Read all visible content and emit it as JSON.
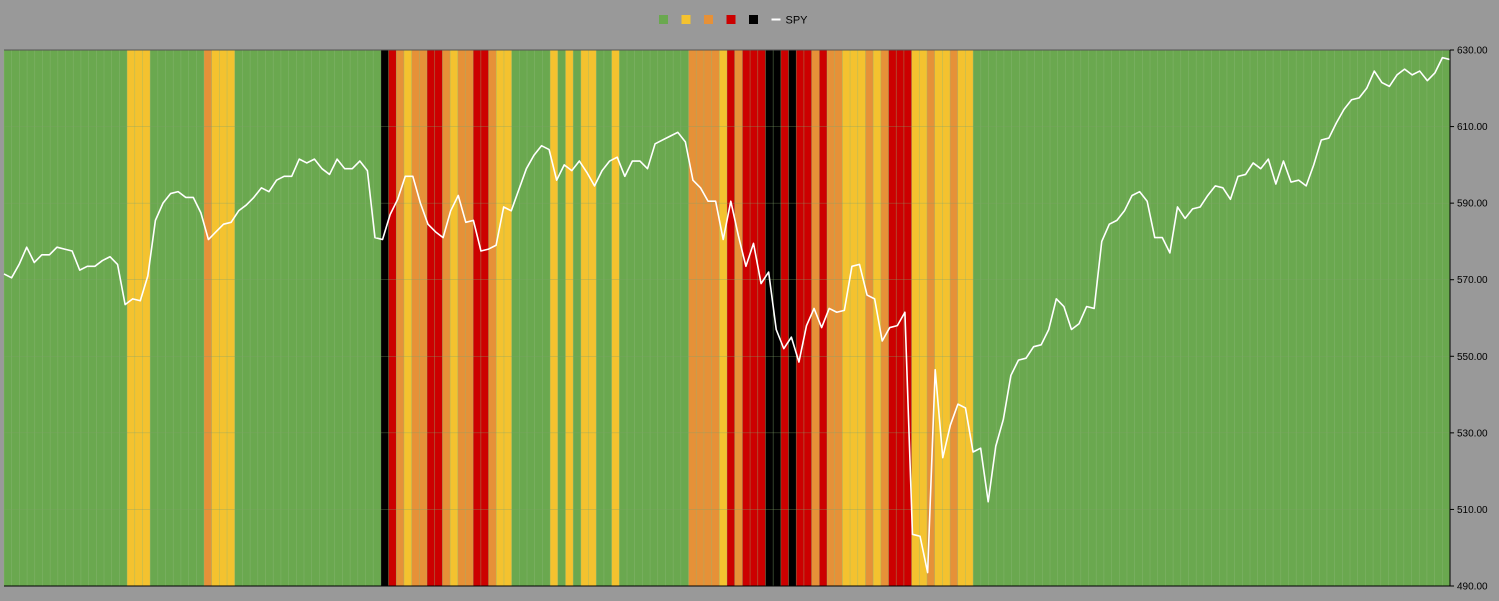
{
  "chart_data": {
    "type": "line",
    "title": "",
    "xlabel": "",
    "ylabel": "",
    "ylim": [
      490,
      630
    ],
    "y_ticks": [
      "490.00",
      "510.00",
      "530.00",
      "550.00",
      "570.00",
      "610.00",
      "590.00",
      "630.00"
    ],
    "y_tick_values": [
      490,
      510,
      530,
      550,
      570,
      610,
      590,
      630
    ],
    "y_axis_side": "right",
    "legend_position": "top-center",
    "background_color": "#999999",
    "plot_background_color": "#6aa84f",
    "regime_colors": {
      "green": "#6aa84f",
      "yellow": "#f4c22f",
      "orange": "#e69138",
      "red": "#cc0000",
      "black": "#000000"
    },
    "legend": [
      {
        "color": "#6aa84f",
        "label": "",
        "marker": "square"
      },
      {
        "color": "#f4c22f",
        "label": "",
        "marker": "square"
      },
      {
        "color": "#e69138",
        "label": "",
        "marker": "square"
      },
      {
        "color": "#cc0000",
        "label": "",
        "marker": "square"
      },
      {
        "color": "#000000",
        "label": "",
        "marker": "square"
      },
      {
        "color": "#ffffff",
        "label": "SPY",
        "marker": "line"
      }
    ],
    "regimes": [
      "green",
      "green",
      "green",
      "green",
      "green",
      "green",
      "green",
      "green",
      "green",
      "green",
      "green",
      "green",
      "green",
      "green",
      "green",
      "green",
      "yellow",
      "yellow",
      "yellow",
      "green",
      "green",
      "green",
      "green",
      "green",
      "green",
      "green",
      "orange",
      "yellow",
      "yellow",
      "yellow",
      "green",
      "green",
      "green",
      "green",
      "green",
      "green",
      "green",
      "green",
      "green",
      "green",
      "green",
      "green",
      "green",
      "green",
      "green",
      "green",
      "green",
      "green",
      "green",
      "black",
      "red",
      "orange",
      "yellow",
      "orange",
      "orange",
      "red",
      "red",
      "orange",
      "yellow",
      "orange",
      "orange",
      "red",
      "red",
      "orange",
      "yellow",
      "yellow",
      "green",
      "green",
      "green",
      "green",
      "green",
      "yellow",
      "green",
      "yellow",
      "green",
      "yellow",
      "yellow",
      "green",
      "green",
      "yellow",
      "green",
      "green",
      "green",
      "green",
      "green",
      "green",
      "green",
      "green",
      "green",
      "orange",
      "orange",
      "orange",
      "orange",
      "yellow",
      "red",
      "orange",
      "red",
      "red",
      "red",
      "black",
      "black",
      "red",
      "black",
      "red",
      "red",
      "orange",
      "red",
      "orange",
      "orange",
      "yellow",
      "yellow",
      "yellow",
      "orange",
      "yellow",
      "orange",
      "red",
      "red",
      "red",
      "yellow",
      "yellow",
      "orange",
      "yellow",
      "yellow",
      "orange",
      "yellow",
      "yellow",
      "green",
      "green",
      "green",
      "green",
      "green",
      "green",
      "green",
      "green",
      "green",
      "green",
      "green",
      "green",
      "green",
      "green",
      "green",
      "green",
      "green",
      "green",
      "green",
      "green",
      "green",
      "green",
      "green",
      "green",
      "green",
      "green",
      "green",
      "green",
      "green",
      "green",
      "green",
      "green",
      "green",
      "green",
      "green",
      "green",
      "green",
      "green",
      "green",
      "green",
      "green",
      "green",
      "green",
      "green",
      "green",
      "green",
      "green",
      "green",
      "green",
      "green",
      "green",
      "green",
      "green",
      "green",
      "green",
      "green",
      "green",
      "green",
      "green",
      "green",
      "green",
      "green"
    ],
    "series": [
      {
        "name": "SPY",
        "color": "#ffffff",
        "values": [
          571.5,
          570.5,
          574,
          578.5,
          574.5,
          576.5,
          576.5,
          578.5,
          578,
          577.5,
          572.5,
          573.5,
          573.5,
          575,
          576,
          574,
          563.5,
          565,
          564.5,
          571,
          585.5,
          590,
          592.5,
          593,
          591.5,
          591.5,
          587.5,
          580.5,
          582.5,
          584.5,
          585,
          588,
          589.5,
          591.5,
          594,
          593,
          596,
          597,
          597,
          601.5,
          600.5,
          601.5,
          599,
          597.5,
          601.5,
          599,
          599,
          601,
          598.5,
          581,
          580.5,
          587,
          591,
          597,
          597,
          590,
          584.5,
          582.5,
          581,
          588,
          592,
          585,
          585.5,
          577.5,
          578,
          579,
          589,
          588,
          593.5,
          599,
          602.5,
          605,
          604,
          596,
          600,
          598.5,
          601,
          598,
          594.5,
          598.5,
          601,
          602,
          597,
          601,
          601,
          599,
          605.5,
          606.5,
          607.5,
          608.5,
          606,
          596,
          594,
          590.5,
          590.5,
          580.5,
          590.5,
          581.5,
          573.5,
          579.5,
          569,
          572,
          557,
          552,
          555,
          548.5,
          558,
          562.5,
          557.5,
          562.5,
          561.5,
          562,
          573.5,
          574,
          566,
          565,
          554,
          557.5,
          558,
          561.5,
          503.5,
          503,
          493.5,
          546.5,
          523.5,
          532,
          537.5,
          536.5,
          525,
          526,
          512,
          526.5,
          533.5,
          545,
          549,
          549.5,
          552.5,
          553,
          557,
          565,
          563,
          557,
          558.5,
          563,
          562.5,
          580,
          584.5,
          585.5,
          588,
          592,
          593,
          590.5,
          581,
          581,
          577,
          589,
          586,
          588.5,
          589,
          592,
          594.5,
          594,
          591,
          597,
          597.5,
          600.5,
          599,
          601.5,
          595,
          601,
          595.5,
          596,
          594.5,
          600,
          606.5,
          607,
          611,
          614.5,
          617,
          617.5,
          620,
          624.5,
          621.5,
          620.5,
          623.5,
          625,
          623.5,
          624.5,
          622,
          624,
          628,
          627.5
        ]
      }
    ]
  }
}
